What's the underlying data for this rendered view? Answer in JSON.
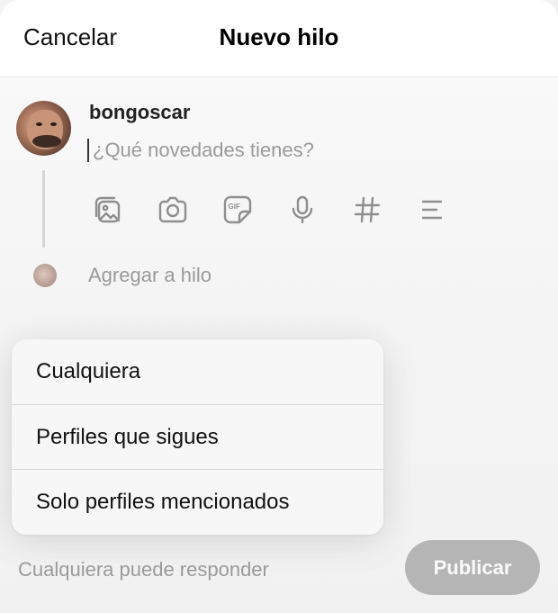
{
  "header": {
    "cancel_label": "Cancelar",
    "title": "Nuevo hilo"
  },
  "post": {
    "username": "bongoscar",
    "placeholder": "¿Qué novedades tienes?"
  },
  "toolbar": {
    "icons": [
      "gallery-icon",
      "camera-icon",
      "gif-icon",
      "microphone-icon",
      "hashtag-icon",
      "poll-icon"
    ]
  },
  "add_thread": {
    "label": "Agregar a hilo"
  },
  "reply_menu": {
    "options": [
      "Cualquiera",
      "Perfiles que sigues",
      "Solo perfiles mencionados"
    ]
  },
  "footer": {
    "reply_setting_text": "Cualquiera puede responder",
    "publish_label": "Publicar"
  },
  "colors": {
    "text_muted": "#9a9a9a",
    "publish_disabled_bg": "#b5b5b5",
    "icon_gray": "#8e8e8e"
  }
}
